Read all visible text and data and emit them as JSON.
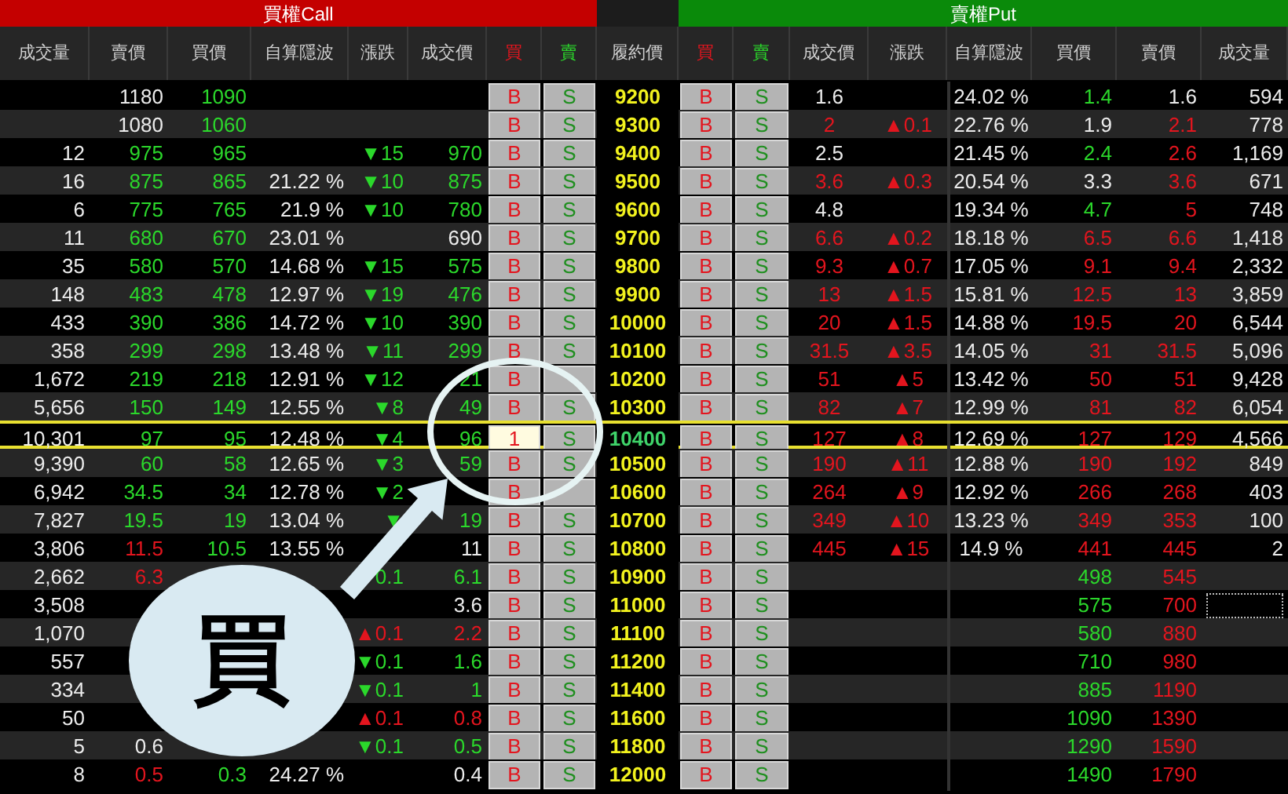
{
  "call_title": "買權Call",
  "put_title": "賣權Put",
  "headers": [
    "成交量",
    "賣價",
    "買價",
    "自算隱波",
    "漲跌",
    "成交價",
    "買",
    "賣",
    "履約價",
    "買",
    "賣",
    "成交價",
    "漲跌",
    "自算隱波",
    "買價",
    "賣價",
    "成交量"
  ],
  "rows": [
    {
      "strike": "9200",
      "selected": false,
      "call": {
        "ask": {
          "text": "1180",
          "kind": "flat"
        },
        "bid": {
          "text": "1090",
          "kind": "down"
        }
      },
      "put": {
        "last": {
          "text": "1.6",
          "kind": "flat"
        },
        "iv": {
          "text": "24.02 %",
          "kind": "flat"
        },
        "bid": {
          "text": "1.4",
          "kind": "down"
        },
        "ask": {
          "text": "1.6",
          "kind": "flat"
        },
        "volume": {
          "text": "594",
          "kind": "flat"
        }
      },
      "buttons": [
        {
          "text": "B",
          "editing": false
        },
        {
          "text": "S",
          "editing": false
        },
        {
          "text": "B",
          "editing": false
        },
        {
          "text": "S",
          "editing": false
        }
      ]
    },
    {
      "strike": "9300",
      "selected": false,
      "call": {
        "ask": {
          "text": "1080",
          "kind": "flat"
        },
        "bid": {
          "text": "1060",
          "kind": "down"
        }
      },
      "put": {
        "last": {
          "text": "2",
          "kind": "up"
        },
        "change": {
          "text": "▲0.1",
          "kind": "up"
        },
        "iv": {
          "text": "22.76 %",
          "kind": "flat"
        },
        "bid": {
          "text": "1.9",
          "kind": "flat"
        },
        "ask": {
          "text": "2.1",
          "kind": "up"
        },
        "volume": {
          "text": "778",
          "kind": "flat"
        }
      },
      "buttons": [
        {
          "text": "B",
          "editing": false
        },
        {
          "text": "S",
          "editing": false
        },
        {
          "text": "B",
          "editing": false
        },
        {
          "text": "S",
          "editing": false
        }
      ]
    },
    {
      "strike": "9400",
      "selected": false,
      "call": {
        "volume": {
          "text": "12",
          "kind": "flat"
        },
        "ask": {
          "text": "975",
          "kind": "down"
        },
        "bid": {
          "text": "965",
          "kind": "down"
        },
        "change": {
          "text": "▼15",
          "kind": "down"
        },
        "last": {
          "text": "970",
          "kind": "down"
        }
      },
      "put": {
        "last": {
          "text": "2.5",
          "kind": "flat"
        },
        "iv": {
          "text": "21.45 %",
          "kind": "flat"
        },
        "bid": {
          "text": "2.4",
          "kind": "down"
        },
        "ask": {
          "text": "2.6",
          "kind": "up"
        },
        "volume": {
          "text": "1,169",
          "kind": "flat"
        }
      },
      "buttons": [
        {
          "text": "B",
          "editing": false
        },
        {
          "text": "S",
          "editing": false
        },
        {
          "text": "B",
          "editing": false
        },
        {
          "text": "S",
          "editing": false
        }
      ]
    },
    {
      "strike": "9500",
      "selected": false,
      "call": {
        "volume": {
          "text": "16",
          "kind": "flat"
        },
        "ask": {
          "text": "875",
          "kind": "down"
        },
        "bid": {
          "text": "865",
          "kind": "down"
        },
        "iv": {
          "text": "21.22 %",
          "kind": "flat"
        },
        "change": {
          "text": "▼10",
          "kind": "down"
        },
        "last": {
          "text": "875",
          "kind": "down"
        }
      },
      "put": {
        "last": {
          "text": "3.6",
          "kind": "up"
        },
        "change": {
          "text": "▲0.3",
          "kind": "up"
        },
        "iv": {
          "text": "20.54 %",
          "kind": "flat"
        },
        "bid": {
          "text": "3.3",
          "kind": "flat"
        },
        "ask": {
          "text": "3.6",
          "kind": "up"
        },
        "volume": {
          "text": "671",
          "kind": "flat"
        }
      },
      "buttons": [
        {
          "text": "B",
          "editing": false
        },
        {
          "text": "S",
          "editing": false
        },
        {
          "text": "B",
          "editing": false
        },
        {
          "text": "S",
          "editing": false
        }
      ]
    },
    {
      "strike": "9600",
      "selected": false,
      "call": {
        "volume": {
          "text": "6",
          "kind": "flat"
        },
        "ask": {
          "text": "775",
          "kind": "down"
        },
        "bid": {
          "text": "765",
          "kind": "down"
        },
        "iv": {
          "text": "21.9 %",
          "kind": "flat"
        },
        "change": {
          "text": "▼10",
          "kind": "down"
        },
        "last": {
          "text": "780",
          "kind": "down"
        }
      },
      "put": {
        "last": {
          "text": "4.8",
          "kind": "flat"
        },
        "iv": {
          "text": "19.34 %",
          "kind": "flat"
        },
        "bid": {
          "text": "4.7",
          "kind": "down"
        },
        "ask": {
          "text": "5",
          "kind": "up"
        },
        "volume": {
          "text": "748",
          "kind": "flat"
        }
      },
      "buttons": [
        {
          "text": "B",
          "editing": false
        },
        {
          "text": "S",
          "editing": false
        },
        {
          "text": "B",
          "editing": false
        },
        {
          "text": "S",
          "editing": false
        }
      ]
    },
    {
      "strike": "9700",
      "selected": false,
      "call": {
        "volume": {
          "text": "11",
          "kind": "flat"
        },
        "ask": {
          "text": "680",
          "kind": "down"
        },
        "bid": {
          "text": "670",
          "kind": "down"
        },
        "iv": {
          "text": "23.01 %",
          "kind": "flat"
        },
        "last": {
          "text": "690",
          "kind": "flat"
        }
      },
      "put": {
        "last": {
          "text": "6.6",
          "kind": "up"
        },
        "change": {
          "text": "▲0.2",
          "kind": "up"
        },
        "iv": {
          "text": "18.18 %",
          "kind": "flat"
        },
        "bid": {
          "text": "6.5",
          "kind": "up"
        },
        "ask": {
          "text": "6.6",
          "kind": "up"
        },
        "volume": {
          "text": "1,418",
          "kind": "flat"
        }
      },
      "buttons": [
        {
          "text": "B",
          "editing": false
        },
        {
          "text": "S",
          "editing": false
        },
        {
          "text": "B",
          "editing": false
        },
        {
          "text": "S",
          "editing": false
        }
      ]
    },
    {
      "strike": "9800",
      "selected": false,
      "call": {
        "volume": {
          "text": "35",
          "kind": "flat"
        },
        "ask": {
          "text": "580",
          "kind": "down"
        },
        "bid": {
          "text": "570",
          "kind": "down"
        },
        "iv": {
          "text": "14.68 %",
          "kind": "flat"
        },
        "change": {
          "text": "▼15",
          "kind": "down"
        },
        "last": {
          "text": "575",
          "kind": "down"
        }
      },
      "put": {
        "last": {
          "text": "9.3",
          "kind": "up"
        },
        "change": {
          "text": "▲0.7",
          "kind": "up"
        },
        "iv": {
          "text": "17.05 %",
          "kind": "flat"
        },
        "bid": {
          "text": "9.1",
          "kind": "up"
        },
        "ask": {
          "text": "9.4",
          "kind": "up"
        },
        "volume": {
          "text": "2,332",
          "kind": "flat"
        }
      },
      "buttons": [
        {
          "text": "B",
          "editing": false
        },
        {
          "text": "S",
          "editing": false
        },
        {
          "text": "B",
          "editing": false
        },
        {
          "text": "S",
          "editing": false
        }
      ]
    },
    {
      "strike": "9900",
      "selected": false,
      "call": {
        "volume": {
          "text": "148",
          "kind": "flat"
        },
        "ask": {
          "text": "483",
          "kind": "down"
        },
        "bid": {
          "text": "478",
          "kind": "down"
        },
        "iv": {
          "text": "12.97 %",
          "kind": "flat"
        },
        "change": {
          "text": "▼19",
          "kind": "down"
        },
        "last": {
          "text": "476",
          "kind": "down"
        }
      },
      "put": {
        "last": {
          "text": "13",
          "kind": "up"
        },
        "change": {
          "text": "▲1.5",
          "kind": "up"
        },
        "iv": {
          "text": "15.81 %",
          "kind": "flat"
        },
        "bid": {
          "text": "12.5",
          "kind": "up"
        },
        "ask": {
          "text": "13",
          "kind": "up"
        },
        "volume": {
          "text": "3,859",
          "kind": "flat"
        }
      },
      "buttons": [
        {
          "text": "B",
          "editing": false
        },
        {
          "text": "S",
          "editing": false
        },
        {
          "text": "B",
          "editing": false
        },
        {
          "text": "S",
          "editing": false
        }
      ]
    },
    {
      "strike": "10000",
      "selected": false,
      "call": {
        "volume": {
          "text": "433",
          "kind": "flat"
        },
        "ask": {
          "text": "390",
          "kind": "down"
        },
        "bid": {
          "text": "386",
          "kind": "down"
        },
        "iv": {
          "text": "14.72 %",
          "kind": "flat"
        },
        "change": {
          "text": "▼10",
          "kind": "down"
        },
        "last": {
          "text": "390",
          "kind": "down"
        }
      },
      "put": {
        "last": {
          "text": "20",
          "kind": "up"
        },
        "change": {
          "text": "▲1.5",
          "kind": "up"
        },
        "iv": {
          "text": "14.88 %",
          "kind": "flat"
        },
        "bid": {
          "text": "19.5",
          "kind": "up"
        },
        "ask": {
          "text": "20",
          "kind": "up"
        },
        "volume": {
          "text": "6,544",
          "kind": "flat"
        }
      },
      "buttons": [
        {
          "text": "B",
          "editing": false
        },
        {
          "text": "S",
          "editing": false
        },
        {
          "text": "B",
          "editing": false
        },
        {
          "text": "S",
          "editing": false
        }
      ]
    },
    {
      "strike": "10100",
      "selected": false,
      "call": {
        "volume": {
          "text": "358",
          "kind": "flat"
        },
        "ask": {
          "text": "299",
          "kind": "down"
        },
        "bid": {
          "text": "298",
          "kind": "down"
        },
        "iv": {
          "text": "13.48 %",
          "kind": "flat"
        },
        "change": {
          "text": "▼11",
          "kind": "down"
        },
        "last": {
          "text": "299",
          "kind": "down"
        }
      },
      "put": {
        "last": {
          "text": "31.5",
          "kind": "up"
        },
        "change": {
          "text": "▲3.5",
          "kind": "up"
        },
        "iv": {
          "text": "14.05 %",
          "kind": "flat"
        },
        "bid": {
          "text": "31",
          "kind": "up"
        },
        "ask": {
          "text": "31.5",
          "kind": "up"
        },
        "volume": {
          "text": "5,096",
          "kind": "flat"
        }
      },
      "buttons": [
        {
          "text": "B",
          "editing": false
        },
        {
          "text": "S",
          "editing": false
        },
        {
          "text": "B",
          "editing": false
        },
        {
          "text": "S",
          "editing": false
        }
      ]
    },
    {
      "strike": "10200",
      "selected": false,
      "call": {
        "volume": {
          "text": "1,672",
          "kind": "flat"
        },
        "ask": {
          "text": "219",
          "kind": "down"
        },
        "bid": {
          "text": "218",
          "kind": "down"
        },
        "iv": {
          "text": "12.91 %",
          "kind": "flat"
        },
        "change": {
          "text": "▼12",
          "kind": "down"
        },
        "last": {
          "text": "21",
          "kind": "down"
        }
      },
      "put": {
        "last": {
          "text": "51",
          "kind": "up"
        },
        "change": {
          "text": "▲5",
          "kind": "up"
        },
        "iv": {
          "text": "13.42 %",
          "kind": "flat"
        },
        "bid": {
          "text": "50",
          "kind": "up"
        },
        "ask": {
          "text": "51",
          "kind": "up"
        },
        "volume": {
          "text": "9,428",
          "kind": "flat"
        }
      },
      "buttons": [
        {
          "text": "B",
          "editing": false
        },
        {
          "editing": false
        },
        {
          "text": "B",
          "editing": false
        },
        {
          "text": "S",
          "editing": false
        }
      ]
    },
    {
      "strike": "10300",
      "selected": false,
      "call": {
        "volume": {
          "text": "5,656",
          "kind": "flat"
        },
        "ask": {
          "text": "150",
          "kind": "down"
        },
        "bid": {
          "text": "149",
          "kind": "down"
        },
        "iv": {
          "text": "12.55 %",
          "kind": "flat"
        },
        "change": {
          "text": "▼8",
          "kind": "down"
        },
        "last": {
          "text": "49",
          "kind": "down"
        }
      },
      "put": {
        "last": {
          "text": "82",
          "kind": "up"
        },
        "change": {
          "text": "▲7",
          "kind": "up"
        },
        "iv": {
          "text": "12.99 %",
          "kind": "flat"
        },
        "bid": {
          "text": "81",
          "kind": "up"
        },
        "ask": {
          "text": "82",
          "kind": "up"
        },
        "volume": {
          "text": "6,054",
          "kind": "flat"
        }
      },
      "buttons": [
        {
          "text": "B",
          "editing": false
        },
        {
          "text": "S",
          "editing": false
        },
        {
          "text": "B",
          "editing": false
        },
        {
          "text": "S",
          "editing": false
        }
      ]
    },
    {
      "strike": "10400",
      "selected": true,
      "call": {
        "volume": {
          "text": "10,301",
          "kind": "flat"
        },
        "ask": {
          "text": "97",
          "kind": "down"
        },
        "bid": {
          "text": "95",
          "kind": "down"
        },
        "iv": {
          "text": "12.48 %",
          "kind": "flat"
        },
        "change": {
          "text": "▼4",
          "kind": "down"
        },
        "last": {
          "text": "96",
          "kind": "down"
        }
      },
      "put": {
        "last": {
          "text": "127",
          "kind": "up"
        },
        "change": {
          "text": "▲8",
          "kind": "up"
        },
        "iv": {
          "text": "12.69 %",
          "kind": "flat"
        },
        "bid": {
          "text": "127",
          "kind": "up"
        },
        "ask": {
          "text": "129",
          "kind": "up"
        },
        "volume": {
          "text": "4,566",
          "kind": "flat"
        }
      },
      "buttons": [
        {
          "text": "1",
          "editing": true
        },
        {
          "text": "S",
          "editing": false
        },
        {
          "text": "B",
          "editing": false
        },
        {
          "text": "S",
          "editing": false
        }
      ]
    },
    {
      "strike": "10500",
      "selected": false,
      "call": {
        "volume": {
          "text": "9,390",
          "kind": "flat"
        },
        "ask": {
          "text": "60",
          "kind": "down"
        },
        "bid": {
          "text": "58",
          "kind": "down"
        },
        "iv": {
          "text": "12.65 %",
          "kind": "flat"
        },
        "change": {
          "text": "▼3",
          "kind": "down"
        },
        "last": {
          "text": "59",
          "kind": "down"
        }
      },
      "put": {
        "last": {
          "text": "190",
          "kind": "up"
        },
        "change": {
          "text": "▲11",
          "kind": "up"
        },
        "iv": {
          "text": "12.88 %",
          "kind": "flat"
        },
        "bid": {
          "text": "190",
          "kind": "up"
        },
        "ask": {
          "text": "192",
          "kind": "up"
        },
        "volume": {
          "text": "849",
          "kind": "flat"
        }
      },
      "buttons": [
        {
          "text": "B",
          "editing": false
        },
        {
          "text": "S",
          "editing": false
        },
        {
          "text": "B",
          "editing": false
        },
        {
          "text": "S",
          "editing": false
        }
      ]
    },
    {
      "strike": "10600",
      "selected": false,
      "call": {
        "volume": {
          "text": "6,942",
          "kind": "flat"
        },
        "ask": {
          "text": "34.5",
          "kind": "down"
        },
        "bid": {
          "text": "34",
          "kind": "down"
        },
        "iv": {
          "text": "12.78 %",
          "kind": "flat"
        },
        "change": {
          "text": "▼2",
          "kind": "down"
        }
      },
      "put": {
        "last": {
          "text": "264",
          "kind": "up"
        },
        "change": {
          "text": "▲9",
          "kind": "up"
        },
        "iv": {
          "text": "12.92 %",
          "kind": "flat"
        },
        "bid": {
          "text": "266",
          "kind": "up"
        },
        "ask": {
          "text": "268",
          "kind": "up"
        },
        "volume": {
          "text": "403",
          "kind": "flat"
        }
      },
      "buttons": [
        {
          "text": "B",
          "editing": false
        },
        {
          "editing": false
        },
        {
          "text": "B",
          "editing": false
        },
        {
          "text": "S",
          "editing": false
        }
      ]
    },
    {
      "strike": "10700",
      "selected": false,
      "call": {
        "volume": {
          "text": "7,827",
          "kind": "flat"
        },
        "ask": {
          "text": "19.5",
          "kind": "down"
        },
        "bid": {
          "text": "19",
          "kind": "down"
        },
        "iv": {
          "text": "13.04 %",
          "kind": "flat"
        },
        "change": {
          "text": "▼",
          "kind": "down"
        },
        "last": {
          "text": "19",
          "kind": "down"
        }
      },
      "put": {
        "last": {
          "text": "349",
          "kind": "up"
        },
        "change": {
          "text": "▲10",
          "kind": "up"
        },
        "iv": {
          "text": "13.23 %",
          "kind": "flat"
        },
        "bid": {
          "text": "349",
          "kind": "up"
        },
        "ask": {
          "text": "353",
          "kind": "up"
        },
        "volume": {
          "text": "100",
          "kind": "flat"
        }
      },
      "buttons": [
        {
          "text": "B",
          "editing": false
        },
        {
          "text": "S",
          "editing": false
        },
        {
          "text": "B",
          "editing": false
        },
        {
          "text": "S",
          "editing": false
        }
      ]
    },
    {
      "strike": "10800",
      "selected": false,
      "call": {
        "volume": {
          "text": "3,806",
          "kind": "flat"
        },
        "ask": {
          "text": "11.5",
          "kind": "up"
        },
        "bid": {
          "text": "10.5",
          "kind": "down"
        },
        "iv": {
          "text": "13.55 %",
          "kind": "flat"
        },
        "last": {
          "text": "11",
          "kind": "flat"
        }
      },
      "put": {
        "last": {
          "text": "445",
          "kind": "up"
        },
        "change": {
          "text": "▲15",
          "kind": "up"
        },
        "iv": {
          "text": "14.9 %",
          "kind": "flat"
        },
        "bid": {
          "text": "441",
          "kind": "up"
        },
        "ask": {
          "text": "445",
          "kind": "up"
        },
        "volume": {
          "text": "2",
          "kind": "flat"
        }
      },
      "buttons": [
        {
          "text": "B",
          "editing": false
        },
        {
          "text": "S",
          "editing": false
        },
        {
          "text": "B",
          "editing": false
        },
        {
          "text": "S",
          "editing": false
        }
      ]
    },
    {
      "strike": "10900",
      "selected": false,
      "call": {
        "volume": {
          "text": "2,662",
          "kind": "flat"
        },
        "ask": {
          "text": "6.3",
          "kind": "up"
        },
        "change": {
          "text": "0.1",
          "kind": "down"
        },
        "last": {
          "text": "6.1",
          "kind": "down"
        }
      },
      "put": {
        "bid": {
          "text": "498",
          "kind": "down"
        },
        "ask": {
          "text": "545",
          "kind": "up"
        }
      },
      "buttons": [
        {
          "text": "B",
          "editing": false
        },
        {
          "text": "S",
          "editing": false
        },
        {
          "text": "B",
          "editing": false
        },
        {
          "text": "S",
          "editing": false
        }
      ]
    },
    {
      "strike": "11000",
      "selected": false,
      "call": {
        "volume": {
          "text": "3,508",
          "kind": "flat"
        },
        "last": {
          "text": "3.6",
          "kind": "flat"
        }
      },
      "put": {
        "bid": {
          "text": "575",
          "kind": "down"
        },
        "ask": {
          "text": "700",
          "kind": "up"
        },
        "volume": {
          "focused": true
        }
      },
      "buttons": [
        {
          "text": "B",
          "editing": false
        },
        {
          "text": "S",
          "editing": false
        },
        {
          "text": "B",
          "editing": false
        },
        {
          "text": "S",
          "editing": false
        }
      ]
    },
    {
      "strike": "11100",
      "selected": false,
      "call": {
        "volume": {
          "text": "1,070",
          "kind": "flat"
        },
        "change": {
          "text": "▲0.1",
          "kind": "up"
        },
        "last": {
          "text": "2.2",
          "kind": "up"
        }
      },
      "put": {
        "bid": {
          "text": "580",
          "kind": "down"
        },
        "ask": {
          "text": "880",
          "kind": "up"
        }
      },
      "buttons": [
        {
          "text": "B",
          "editing": false
        },
        {
          "text": "S",
          "editing": false
        },
        {
          "text": "B",
          "editing": false
        },
        {
          "text": "S",
          "editing": false
        }
      ]
    },
    {
      "strike": "11200",
      "selected": false,
      "call": {
        "volume": {
          "text": "557",
          "kind": "flat"
        },
        "change": {
          "text": "▼0.1",
          "kind": "down"
        },
        "last": {
          "text": "1.6",
          "kind": "down"
        }
      },
      "put": {
        "bid": {
          "text": "710",
          "kind": "down"
        },
        "ask": {
          "text": "980",
          "kind": "up"
        }
      },
      "buttons": [
        {
          "text": "B",
          "editing": false
        },
        {
          "text": "S",
          "editing": false
        },
        {
          "text": "B",
          "editing": false
        },
        {
          "text": "S",
          "editing": false
        }
      ]
    },
    {
      "strike": "11400",
      "selected": false,
      "call": {
        "volume": {
          "text": "334",
          "kind": "flat"
        },
        "change": {
          "text": "▼0.1",
          "kind": "down"
        },
        "last": {
          "text": "1",
          "kind": "down"
        }
      },
      "put": {
        "bid": {
          "text": "885",
          "kind": "down"
        },
        "ask": {
          "text": "1190",
          "kind": "up"
        }
      },
      "buttons": [
        {
          "text": "B",
          "editing": false
        },
        {
          "text": "S",
          "editing": false
        },
        {
          "text": "B",
          "editing": false
        },
        {
          "text": "S",
          "editing": false
        }
      ]
    },
    {
      "strike": "11600",
      "selected": false,
      "call": {
        "volume": {
          "text": "50",
          "kind": "flat"
        },
        "change": {
          "text": "▲0.1",
          "kind": "up"
        },
        "last": {
          "text": "0.8",
          "kind": "up"
        }
      },
      "put": {
        "bid": {
          "text": "1090",
          "kind": "down"
        },
        "ask": {
          "text": "1390",
          "kind": "up"
        }
      },
      "buttons": [
        {
          "text": "B",
          "editing": false
        },
        {
          "text": "S",
          "editing": false
        },
        {
          "text": "B",
          "editing": false
        },
        {
          "text": "S",
          "editing": false
        }
      ]
    },
    {
      "strike": "11800",
      "selected": false,
      "call": {
        "volume": {
          "text": "5",
          "kind": "flat"
        },
        "ask": {
          "text": "0.6",
          "kind": "flat"
        },
        "change": {
          "text": "▼0.1",
          "kind": "down"
        },
        "last": {
          "text": "0.5",
          "kind": "down"
        }
      },
      "put": {
        "bid": {
          "text": "1290",
          "kind": "down"
        },
        "ask": {
          "text": "1590",
          "kind": "up"
        }
      },
      "buttons": [
        {
          "text": "B",
          "editing": false
        },
        {
          "text": "S",
          "editing": false
        },
        {
          "text": "B",
          "editing": false
        },
        {
          "text": "S",
          "editing": false
        }
      ]
    },
    {
      "strike": "12000",
      "selected": false,
      "call": {
        "volume": {
          "text": "8",
          "kind": "flat"
        },
        "ask": {
          "text": "0.5",
          "kind": "up"
        },
        "bid": {
          "text": "0.3",
          "kind": "down"
        },
        "iv": {
          "text": "24.27 %",
          "kind": "flat"
        },
        "last": {
          "text": "0.4",
          "kind": "flat"
        }
      },
      "put": {
        "bid": {
          "text": "1490",
          "kind": "down"
        },
        "ask": {
          "text": "1790",
          "kind": "up"
        }
      },
      "buttons": [
        {
          "text": "B",
          "editing": false
        },
        {
          "text": "S",
          "editing": false
        },
        {
          "text": "B",
          "editing": false
        },
        {
          "text": "S",
          "editing": false
        }
      ]
    }
  ],
  "callout": {
    "text": "買"
  }
}
